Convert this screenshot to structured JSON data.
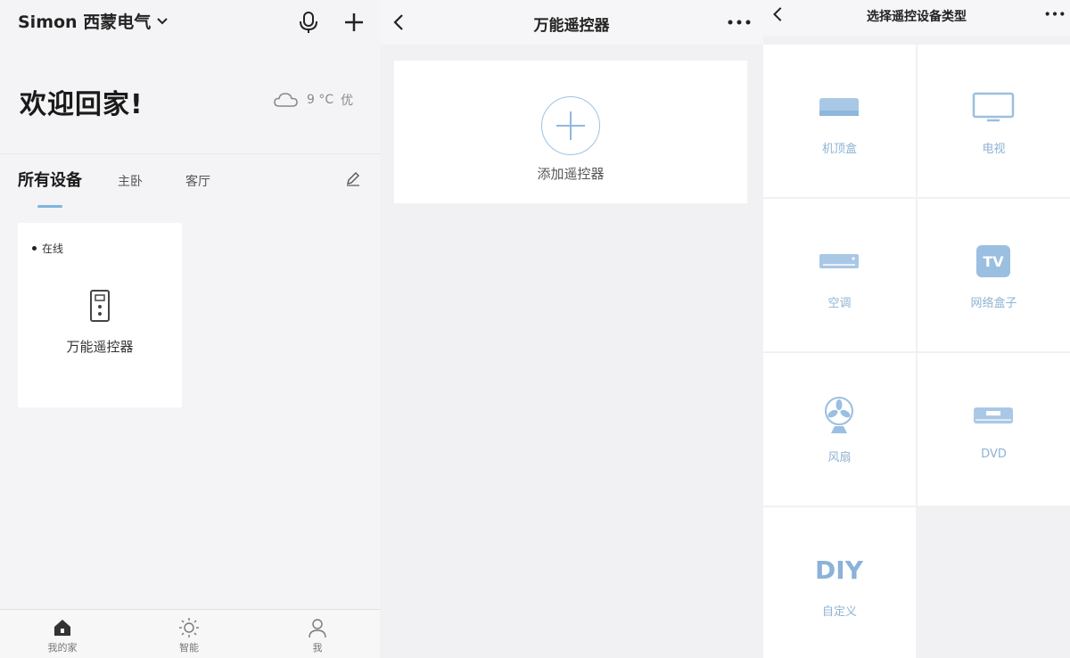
{
  "home": {
    "brand": "Simon 西蒙电气",
    "welcome": "欢迎回家!",
    "weather": {
      "temp": "9 °C",
      "quality": "优"
    },
    "tabs": [
      "所有设备",
      "主卧",
      "客厅"
    ],
    "device": {
      "status": "在线",
      "name": "万能遥控器"
    },
    "nav": [
      "我的家",
      "智能",
      "我"
    ]
  },
  "remote": {
    "title": "万能遥控器",
    "add_label": "添加遥控器"
  },
  "select": {
    "title": "选择遥控设备类型",
    "types": [
      "机顶盒",
      "电视",
      "空调",
      "网络盒子",
      "风扇",
      "DVD",
      "自定义"
    ],
    "diy_text": "DIY",
    "tv_badge": "TV"
  },
  "colors": {
    "accent": "#7fb5e0",
    "icon_blue": "#9bbfe0"
  }
}
